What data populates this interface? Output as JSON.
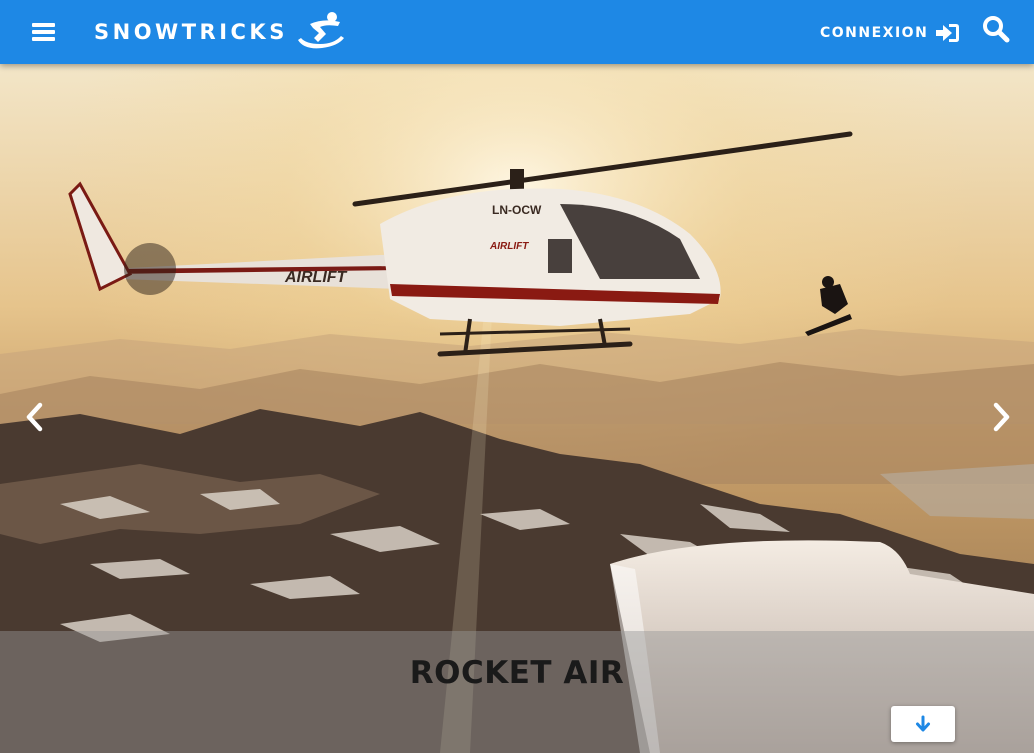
{
  "navbar": {
    "brand_label": "SNOWTRICKS",
    "login_label": "CONNEXION",
    "icons": {
      "menu": "hamburger-menu-icon",
      "brand_logo": "snowboarder-logo-icon",
      "login": "sign-in-icon",
      "search": "search-icon"
    },
    "color": "#1e88e5"
  },
  "hero": {
    "image": "helicopter-snowboarder-sunset-photo",
    "prev_icon": "chevron-left-icon",
    "next_icon": "chevron-right-icon"
  },
  "trick": {
    "title": "ROCKET AIR"
  },
  "scroll_button": {
    "icon": "arrow-down-icon",
    "color": "#1e88e5"
  }
}
